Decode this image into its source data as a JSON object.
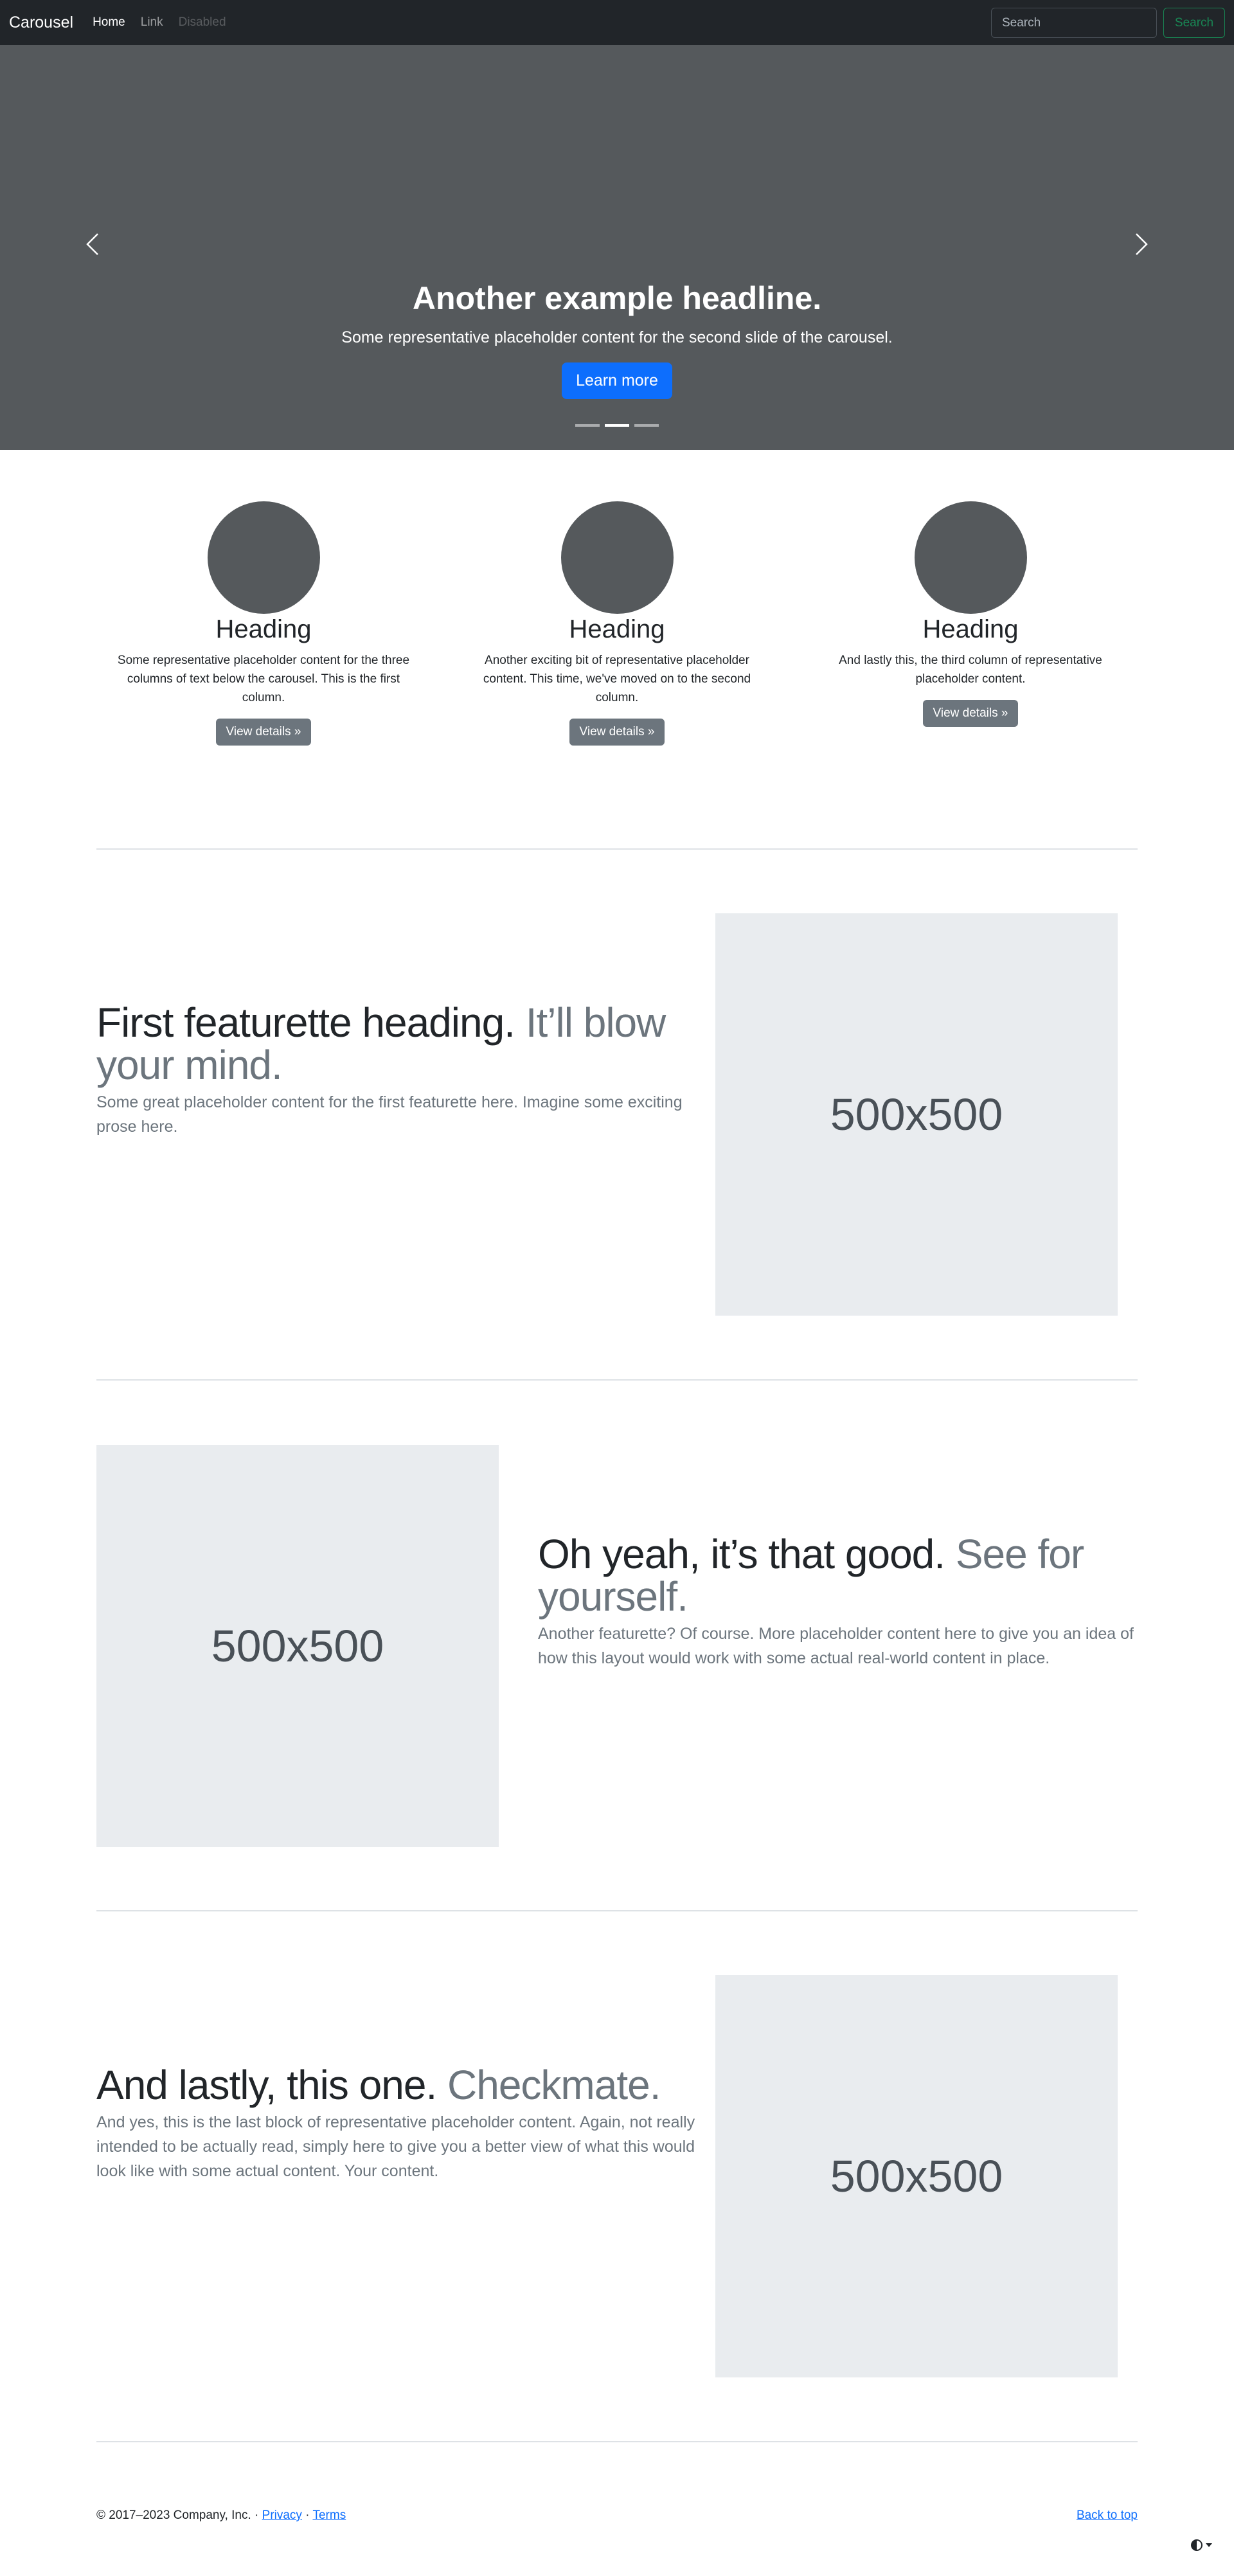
{
  "navbar": {
    "brand": "Carousel",
    "links": [
      {
        "label": "Home"
      },
      {
        "label": "Link"
      },
      {
        "label": "Disabled"
      }
    ],
    "search": {
      "placeholder": "Search",
      "button_label": "Search"
    }
  },
  "carousel": {
    "headline": "Another example headline.",
    "text": "Some representative placeholder content for the second slide of the carousel.",
    "button_label": "Learn more",
    "slide_count": 3,
    "active_slide": 2
  },
  "columns": [
    {
      "heading": "Heading",
      "text": "Some representative placeholder content for the three columns of text below the carousel. This is the first column.",
      "button_label": "View details »"
    },
    {
      "heading": "Heading",
      "text": "Another exciting bit of representative placeholder content. This time, we've moved on to the second column.",
      "button_label": "View details »"
    },
    {
      "heading": "Heading",
      "text": "And lastly this, the third column of representative placeholder content.",
      "button_label": "View details »"
    }
  ],
  "featurettes": [
    {
      "heading": "First featurette heading.",
      "heading_muted": "It’ll blow your mind.",
      "text": "Some great placeholder content for the first featurette here. Imagine some exciting prose here.",
      "image_label": "500x500"
    },
    {
      "heading": "Oh yeah, it’s that good.",
      "heading_muted": "See for yourself.",
      "text": "Another featurette? Of course. More placeholder content here to give you an idea of how this layout would work with some actual real-world content in place.",
      "image_label": "500x500"
    },
    {
      "heading": "And lastly, this one.",
      "heading_muted": "Checkmate.",
      "text": "And yes, this is the last block of representative placeholder content. Again, not really intended to be actually read, simply here to give you a better view of what this would look like with some actual content. Your content.",
      "image_label": "500x500"
    }
  ],
  "footer": {
    "copyright": "© 2017–2023 Company, Inc. · ",
    "privacy": "Privacy",
    "separator": " · ",
    "terms": "Terms",
    "back_to_top": "Back to top"
  },
  "colors": {
    "navbar_bg": "#212529",
    "carousel_bg": "#55595c",
    "primary": "#0d6efd",
    "secondary": "#6c757d",
    "success": "#198754",
    "placeholder_bg": "#e9ecef"
  },
  "icons": [
    "chevron-left-icon",
    "chevron-right-icon",
    "theme-toggle-icon",
    "caret-down-icon"
  ]
}
